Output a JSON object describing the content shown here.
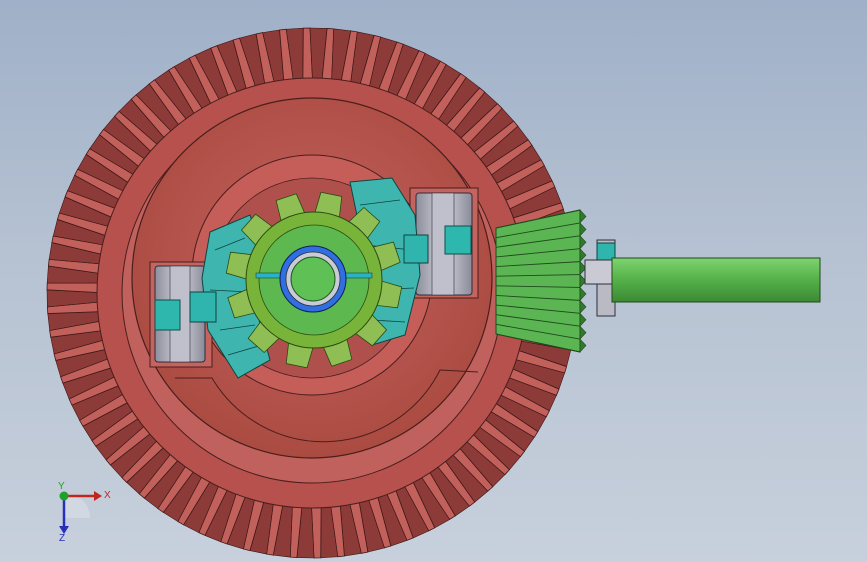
{
  "viewport": {
    "background_top": "#9fb0c8",
    "background_bottom": "#c7d0dc"
  },
  "model": {
    "ring_gear_color": "#c2605c",
    "ring_gear_dark": "#8c3b38",
    "carrier_color": "#b85552",
    "pinion_color": "#5ab552",
    "pinion_dark": "#2f7a2c",
    "shaft_color": "#5fba55",
    "side_gear_color": "#8fbf54",
    "spider_color": "#3fb7b0",
    "bearing_color": "#a9aab6",
    "collar_color": "#2bb3b0"
  },
  "triad": {
    "x_label": "X",
    "y_label": "Y",
    "z_label": "Z",
    "x_color": "#c0261e",
    "y_color": "#1ea02a",
    "z_color": "#2630b8",
    "icons": [
      "coordinate-triad-icon"
    ]
  }
}
